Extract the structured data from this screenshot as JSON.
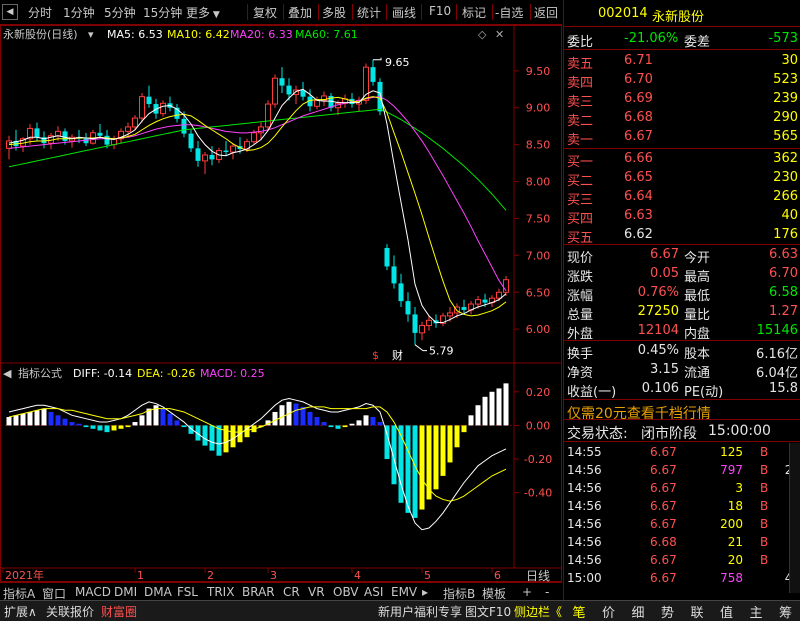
{
  "toolbar": {
    "left_items": [
      "分时",
      "1分钟",
      "5分钟",
      "15分钟",
      "更多"
    ],
    "right_items": [
      "复权",
      "叠加",
      "多股",
      "统计",
      "画线",
      "F10",
      "标记",
      "-自选",
      "返回"
    ]
  },
  "chart_header": {
    "stock_title": "永新股份(日线)",
    "ma5_label": "MA5: 6.53",
    "ma10_label": "MA10: 6.42",
    "ma20_label": "MA20: 6.33",
    "ma60_label": "MA60: 7.61"
  },
  "macd_header": {
    "title": "指标公式",
    "diff_label": "DIFF: -0.14",
    "dea_label": "DEA: -0.26",
    "macd_label": "MACD: 0.25"
  },
  "colors": {
    "up": "#ff3c3c",
    "down": "#00e6e6",
    "ma5": "#ffffff",
    "ma10": "#ffff00",
    "ma20": "#ff40ff",
    "ma60": "#00e600",
    "axis_border": "#800000"
  },
  "chart_data": [
    {
      "type": "candlestick",
      "price_axis_ticks": [
        "9.50",
        "9.00",
        "8.50",
        "8.00",
        "7.50",
        "7.00",
        "6.50",
        "6.00"
      ],
      "ylim": [
        5.65,
        9.85
      ],
      "max_annotation": "9.65",
      "min_annotation": "5.79",
      "high_value": 9.65,
      "low_value": 5.79,
      "event_markers": [
        "$",
        "财"
      ],
      "ohlc": [
        [
          8.45,
          8.62,
          8.3,
          8.55
        ],
        [
          8.55,
          8.7,
          8.42,
          8.48
        ],
        [
          8.48,
          8.6,
          8.4,
          8.58
        ],
        [
          8.58,
          8.78,
          8.5,
          8.72
        ],
        [
          8.72,
          8.8,
          8.55,
          8.6
        ],
        [
          8.6,
          8.68,
          8.45,
          8.52
        ],
        [
          8.52,
          8.66,
          8.44,
          8.62
        ],
        [
          8.62,
          8.75,
          8.55,
          8.68
        ],
        [
          8.68,
          8.72,
          8.5,
          8.55
        ],
        [
          8.55,
          8.64,
          8.46,
          8.6
        ],
        [
          8.6,
          8.7,
          8.52,
          8.58
        ],
        [
          8.58,
          8.66,
          8.48,
          8.52
        ],
        [
          8.52,
          8.7,
          8.5,
          8.66
        ],
        [
          8.66,
          8.78,
          8.58,
          8.62
        ],
        [
          8.62,
          8.7,
          8.45,
          8.5
        ],
        [
          8.5,
          8.62,
          8.44,
          8.58
        ],
        [
          8.58,
          8.72,
          8.52,
          8.68
        ],
        [
          8.68,
          8.8,
          8.6,
          8.74
        ],
        [
          8.74,
          8.9,
          8.7,
          8.86
        ],
        [
          8.86,
          9.2,
          8.8,
          9.15
        ],
        [
          9.15,
          9.3,
          9.0,
          9.05
        ],
        [
          9.05,
          9.12,
          8.85,
          8.92
        ],
        [
          8.92,
          9.1,
          8.88,
          9.06
        ],
        [
          9.06,
          9.15,
          8.95,
          9.0
        ],
        [
          9.0,
          9.05,
          8.8,
          8.85
        ],
        [
          8.85,
          8.95,
          8.6,
          8.65
        ],
        [
          8.65,
          8.7,
          8.4,
          8.45
        ],
        [
          8.45,
          8.55,
          8.2,
          8.28
        ],
        [
          8.28,
          8.4,
          8.1,
          8.36
        ],
        [
          8.36,
          8.48,
          8.22,
          8.3
        ],
        [
          8.3,
          8.46,
          8.25,
          8.42
        ],
        [
          8.42,
          8.55,
          8.35,
          8.4
        ],
        [
          8.4,
          8.52,
          8.3,
          8.48
        ],
        [
          8.48,
          8.6,
          8.38,
          8.44
        ],
        [
          8.44,
          8.58,
          8.4,
          8.54
        ],
        [
          8.54,
          8.7,
          8.5,
          8.66
        ],
        [
          8.66,
          8.8,
          8.56,
          8.74
        ],
        [
          8.74,
          9.1,
          8.7,
          9.05
        ],
        [
          9.05,
          9.45,
          9.0,
          9.4
        ],
        [
          9.4,
          9.55,
          9.2,
          9.3
        ],
        [
          9.3,
          9.4,
          9.1,
          9.18
        ],
        [
          9.18,
          9.3,
          9.05,
          9.24
        ],
        [
          9.24,
          9.35,
          9.1,
          9.15
        ],
        [
          9.15,
          9.25,
          8.95,
          9.02
        ],
        [
          9.02,
          9.15,
          8.98,
          9.1
        ],
        [
          9.1,
          9.22,
          9.02,
          9.16
        ],
        [
          9.16,
          9.2,
          8.95,
          9.0
        ],
        [
          9.0,
          9.1,
          8.9,
          9.06
        ],
        [
          9.06,
          9.18,
          9.0,
          9.12
        ],
        [
          9.12,
          9.2,
          9.0,
          9.05
        ],
        [
          9.05,
          9.15,
          8.95,
          9.1
        ],
        [
          9.1,
          9.6,
          9.05,
          9.55
        ],
        [
          9.55,
          9.65,
          9.3,
          9.35
        ],
        [
          9.35,
          9.4,
          8.9,
          8.95
        ],
        [
          7.1,
          7.15,
          6.8,
          6.85
        ],
        [
          6.85,
          7.0,
          6.55,
          6.62
        ],
        [
          6.62,
          6.75,
          6.3,
          6.38
        ],
        [
          6.38,
          6.5,
          6.1,
          6.2
        ],
        [
          6.2,
          6.3,
          5.79,
          5.95
        ],
        [
          5.95,
          6.1,
          5.85,
          6.05
        ],
        [
          6.05,
          6.18,
          5.98,
          6.12
        ],
        [
          6.12,
          6.2,
          6.02,
          6.08
        ],
        [
          6.08,
          6.22,
          6.04,
          6.18
        ],
        [
          6.18,
          6.3,
          6.1,
          6.22
        ],
        [
          6.22,
          6.35,
          6.15,
          6.3
        ],
        [
          6.3,
          6.4,
          6.2,
          6.26
        ],
        [
          6.26,
          6.38,
          6.2,
          6.34
        ],
        [
          6.34,
          6.45,
          6.28,
          6.4
        ],
        [
          6.4,
          6.48,
          6.3,
          6.36
        ],
        [
          6.36,
          6.46,
          6.3,
          6.42
        ],
        [
          6.42,
          6.55,
          6.38,
          6.5
        ],
        [
          6.5,
          6.72,
          6.45,
          6.67
        ]
      ],
      "ma5": [
        8.52,
        8.54,
        8.56,
        8.6,
        8.6,
        8.58,
        8.6,
        8.62,
        8.6,
        8.58,
        8.6,
        8.59,
        8.58,
        8.6,
        8.58,
        8.57,
        8.6,
        8.64,
        8.7,
        8.82,
        8.92,
        8.98,
        9.02,
        9.03,
        8.98,
        8.9,
        8.78,
        8.62,
        8.5,
        8.41,
        8.36,
        8.35,
        8.39,
        8.41,
        8.44,
        8.5,
        8.57,
        8.69,
        8.86,
        9.03,
        9.13,
        9.22,
        9.25,
        9.18,
        9.1,
        9.09,
        9.09,
        9.07,
        9.07,
        9.07,
        9.07,
        9.18,
        9.23,
        9.2,
        8.78,
        8.24,
        7.72,
        7.21,
        6.61,
        6.32,
        6.18,
        6.09,
        6.09,
        6.13,
        6.18,
        6.21,
        6.26,
        6.3,
        6.33,
        6.36,
        6.4,
        6.48
      ],
      "ma10": [
        8.5,
        8.51,
        8.52,
        8.54,
        8.55,
        8.55,
        8.56,
        8.58,
        8.58,
        8.58,
        8.59,
        8.59,
        8.59,
        8.6,
        8.59,
        8.58,
        8.59,
        8.61,
        8.64,
        8.7,
        8.76,
        8.81,
        8.85,
        8.88,
        8.9,
        8.91,
        8.89,
        8.83,
        8.76,
        8.7,
        8.64,
        8.58,
        8.51,
        8.46,
        8.42,
        8.43,
        8.46,
        8.52,
        8.62,
        8.74,
        8.85,
        8.96,
        9.05,
        9.1,
        9.11,
        9.11,
        9.13,
        9.14,
        9.12,
        9.09,
        9.08,
        9.13,
        9.15,
        9.13,
        8.93,
        8.66,
        8.4,
        8.12,
        7.84,
        7.55,
        7.24,
        6.94,
        6.65,
        6.39,
        6.25,
        6.2,
        6.18,
        6.19,
        6.22,
        6.25,
        6.3,
        6.37
      ],
      "ma20": [
        8.45,
        8.46,
        8.47,
        8.48,
        8.49,
        8.5,
        8.51,
        8.52,
        8.53,
        8.54,
        8.55,
        8.56,
        8.57,
        8.58,
        8.58,
        8.58,
        8.59,
        8.6,
        8.62,
        8.65,
        8.68,
        8.71,
        8.73,
        8.75,
        8.76,
        8.77,
        8.77,
        8.76,
        8.74,
        8.72,
        8.7,
        8.68,
        8.67,
        8.66,
        8.66,
        8.67,
        8.68,
        8.7,
        8.73,
        8.77,
        8.81,
        8.85,
        8.89,
        8.92,
        8.95,
        8.98,
        9.01,
        9.04,
        9.06,
        9.08,
        9.1,
        9.12,
        9.14,
        9.15,
        9.1,
        9.02,
        8.92,
        8.81,
        8.68,
        8.55,
        8.4,
        8.24,
        8.08,
        7.91,
        7.74,
        7.57,
        7.39,
        7.2,
        7.02,
        6.84,
        6.66,
        6.52
      ],
      "ma60": [
        8.2,
        8.22,
        8.24,
        8.26,
        8.28,
        8.3,
        8.32,
        8.34,
        8.36,
        8.38,
        8.4,
        8.42,
        8.44,
        8.46,
        8.48,
        8.5,
        8.52,
        8.54,
        8.56,
        8.58,
        8.6,
        8.62,
        8.64,
        8.66,
        8.68,
        8.7,
        8.71,
        8.72,
        8.73,
        8.74,
        8.75,
        8.76,
        8.77,
        8.78,
        8.79,
        8.8,
        8.81,
        8.82,
        8.83,
        8.84,
        8.85,
        8.86,
        8.87,
        8.88,
        8.89,
        8.9,
        8.91,
        8.92,
        8.93,
        8.94,
        8.95,
        8.96,
        8.97,
        8.98,
        8.94,
        8.89,
        8.84,
        8.78,
        8.72,
        8.66,
        8.59,
        8.52,
        8.45,
        8.37,
        8.29,
        8.21,
        8.12,
        8.03,
        7.93,
        7.83,
        7.72,
        7.61
      ],
      "x_tick_labels": [
        "2021年",
        "1",
        "2",
        "3",
        "4",
        "5",
        "6"
      ]
    },
    {
      "type": "macd",
      "axis_ticks": [
        "0.20",
        "0.00",
        "-0.20",
        "-0.40"
      ],
      "ylim": [
        -0.8,
        0.27
      ],
      "hist": [
        0.05,
        0.06,
        0.07,
        0.08,
        0.09,
        0.1,
        0.08,
        0.06,
        0.04,
        0.02,
        0.01,
        -0.01,
        -0.02,
        -0.03,
        -0.04,
        -0.03,
        -0.02,
        -0.01,
        0.02,
        0.06,
        0.1,
        0.12,
        0.1,
        0.07,
        0.03,
        -0.01,
        -0.05,
        -0.09,
        -0.12,
        -0.15,
        -0.18,
        -0.16,
        -0.13,
        -0.1,
        -0.07,
        -0.04,
        -0.01,
        0.03,
        0.08,
        0.12,
        0.14,
        0.13,
        0.11,
        0.08,
        0.05,
        0.02,
        -0.01,
        -0.02,
        -0.01,
        0.01,
        0.03,
        0.06,
        0.05,
        0.02,
        -0.2,
        -0.35,
        -0.46,
        -0.52,
        -0.55,
        -0.5,
        -0.44,
        -0.38,
        -0.3,
        -0.22,
        -0.13,
        -0.04,
        0.06,
        0.12,
        0.17,
        0.2,
        0.22,
        0.25
      ],
      "diff": [
        0.08,
        0.09,
        0.1,
        0.11,
        0.12,
        0.12,
        0.11,
        0.1,
        0.08,
        0.06,
        0.05,
        0.04,
        0.03,
        0.02,
        0.02,
        0.03,
        0.04,
        0.06,
        0.09,
        0.12,
        0.14,
        0.13,
        0.11,
        0.08,
        0.05,
        0.02,
        -0.02,
        -0.05,
        -0.08,
        -0.1,
        -0.11,
        -0.1,
        -0.08,
        -0.05,
        -0.02,
        0.01,
        0.04,
        0.08,
        0.12,
        0.15,
        0.16,
        0.15,
        0.14,
        0.12,
        0.1,
        0.09,
        0.08,
        0.08,
        0.09,
        0.1,
        0.11,
        0.13,
        0.12,
        0.08,
        -0.05,
        -0.2,
        -0.35,
        -0.48,
        -0.58,
        -0.62,
        -0.61,
        -0.57,
        -0.52,
        -0.46,
        -0.4,
        -0.34,
        -0.29,
        -0.24,
        -0.21,
        -0.18,
        -0.16,
        -0.14
      ],
      "dea": [
        0.05,
        0.06,
        0.07,
        0.08,
        0.09,
        0.1,
        0.1,
        0.1,
        0.09,
        0.09,
        0.08,
        0.07,
        0.06,
        0.05,
        0.04,
        0.04,
        0.04,
        0.05,
        0.06,
        0.07,
        0.09,
        0.1,
        0.1,
        0.1,
        0.09,
        0.08,
        0.06,
        0.04,
        0.02,
        0.0,
        -0.02,
        -0.03,
        -0.04,
        -0.04,
        -0.03,
        -0.02,
        -0.01,
        0.01,
        0.03,
        0.05,
        0.07,
        0.09,
        0.1,
        0.11,
        0.11,
        0.11,
        0.1,
        0.1,
        0.1,
        0.1,
        0.1,
        0.1,
        0.11,
        0.11,
        0.08,
        0.02,
        -0.06,
        -0.15,
        -0.24,
        -0.32,
        -0.38,
        -0.42,
        -0.44,
        -0.45,
        -0.44,
        -0.42,
        -0.39,
        -0.36,
        -0.33,
        -0.3,
        -0.28,
        -0.26
      ]
    }
  ],
  "right_panel": {
    "code": "002014",
    "name": "永新股份",
    "weibi_label": "委比",
    "weibi": "-21.06%",
    "weicha_label": "委差",
    "weicha": "-573",
    "asks": [
      {
        "label": "卖五",
        "price": "6.71",
        "vol": "30"
      },
      {
        "label": "卖四",
        "price": "6.70",
        "vol": "523"
      },
      {
        "label": "卖三",
        "price": "6.69",
        "vol": "239"
      },
      {
        "label": "卖二",
        "price": "6.68",
        "vol": "290"
      },
      {
        "label": "卖一",
        "price": "6.67",
        "vol": "565"
      }
    ],
    "bids": [
      {
        "label": "买一",
        "price": "6.66",
        "vol": "362"
      },
      {
        "label": "买二",
        "price": "6.65",
        "vol": "230"
      },
      {
        "label": "买三",
        "price": "6.64",
        "vol": "266"
      },
      {
        "label": "买四",
        "price": "6.63",
        "vol": "40"
      },
      {
        "label": "买五",
        "price": "6.62",
        "vol": "176"
      }
    ],
    "stats": [
      {
        "l1": "现价",
        "v1": "6.67",
        "l2": "今开",
        "v2": "6.63"
      },
      {
        "l1": "涨跌",
        "v1": "0.05",
        "l2": "最高",
        "v2": "6.70"
      },
      {
        "l1": "涨幅",
        "v1": "0.76%",
        "l2": "最低",
        "v2": "6.58"
      },
      {
        "l1": "总量",
        "v1": "27250",
        "l2": "量比",
        "v2": "1.27"
      },
      {
        "l1": "外盘",
        "v1": "12104",
        "l2": "内盘",
        "v2": "15146"
      }
    ],
    "stats2": [
      {
        "l1": "换手",
        "v1": "0.45%",
        "l2": "股本",
        "v2": "6.16亿"
      },
      {
        "l1": "净资",
        "v1": "3.15",
        "l2": "流通",
        "v2": "6.04亿"
      },
      {
        "l1": "收益(一)",
        "v1": "0.106",
        "l2": "PE(动)",
        "v2": "15.8"
      }
    ],
    "promo": "仅需20元查看千档行情",
    "trade_state_label": "交易状态:",
    "trade_state": "闭市阶段",
    "trade_time": "15:00:00",
    "ticks": [
      {
        "time": "14:55",
        "price": "6.67",
        "vol": "125",
        "side": "B",
        "n": "4"
      },
      {
        "time": "14:56",
        "price": "6.67",
        "vol": "797",
        "side": "B",
        "n": "25"
      },
      {
        "time": "14:56",
        "price": "6.67",
        "vol": "3",
        "side": "B",
        "n": "1"
      },
      {
        "time": "14:56",
        "price": "6.67",
        "vol": "18",
        "side": "B",
        "n": "3"
      },
      {
        "time": "14:56",
        "price": "6.67",
        "vol": "200",
        "side": "B",
        "n": "5"
      },
      {
        "time": "14:56",
        "price": "6.68",
        "vol": "21",
        "side": "B",
        "n": "3"
      },
      {
        "time": "14:56",
        "price": "6.67",
        "vol": "20",
        "side": "B",
        "n": "1"
      },
      {
        "time": "15:00",
        "price": "6.67",
        "vol": "758",
        "side": "",
        "n": "43"
      }
    ]
  },
  "bottom_tabs": {
    "left": [
      "指标A",
      "窗口",
      "MACD",
      "DMI",
      "DMA",
      "FSL",
      "TRIX",
      "BRAR",
      "CR",
      "VR",
      "OBV",
      "ASI",
      "EMV"
    ],
    "right": [
      "指标B",
      "模板",
      "+",
      "-"
    ],
    "period_label": "日线"
  },
  "status_bar": {
    "items": [
      "扩展∧",
      "关联报价",
      "财富圈"
    ],
    "right_items": [
      "新用户福利专享",
      "图文F10",
      "侧边栏《"
    ],
    "right_tabs": [
      "笔",
      "价",
      "细",
      "势",
      "联",
      "值",
      "主",
      "筹"
    ]
  }
}
